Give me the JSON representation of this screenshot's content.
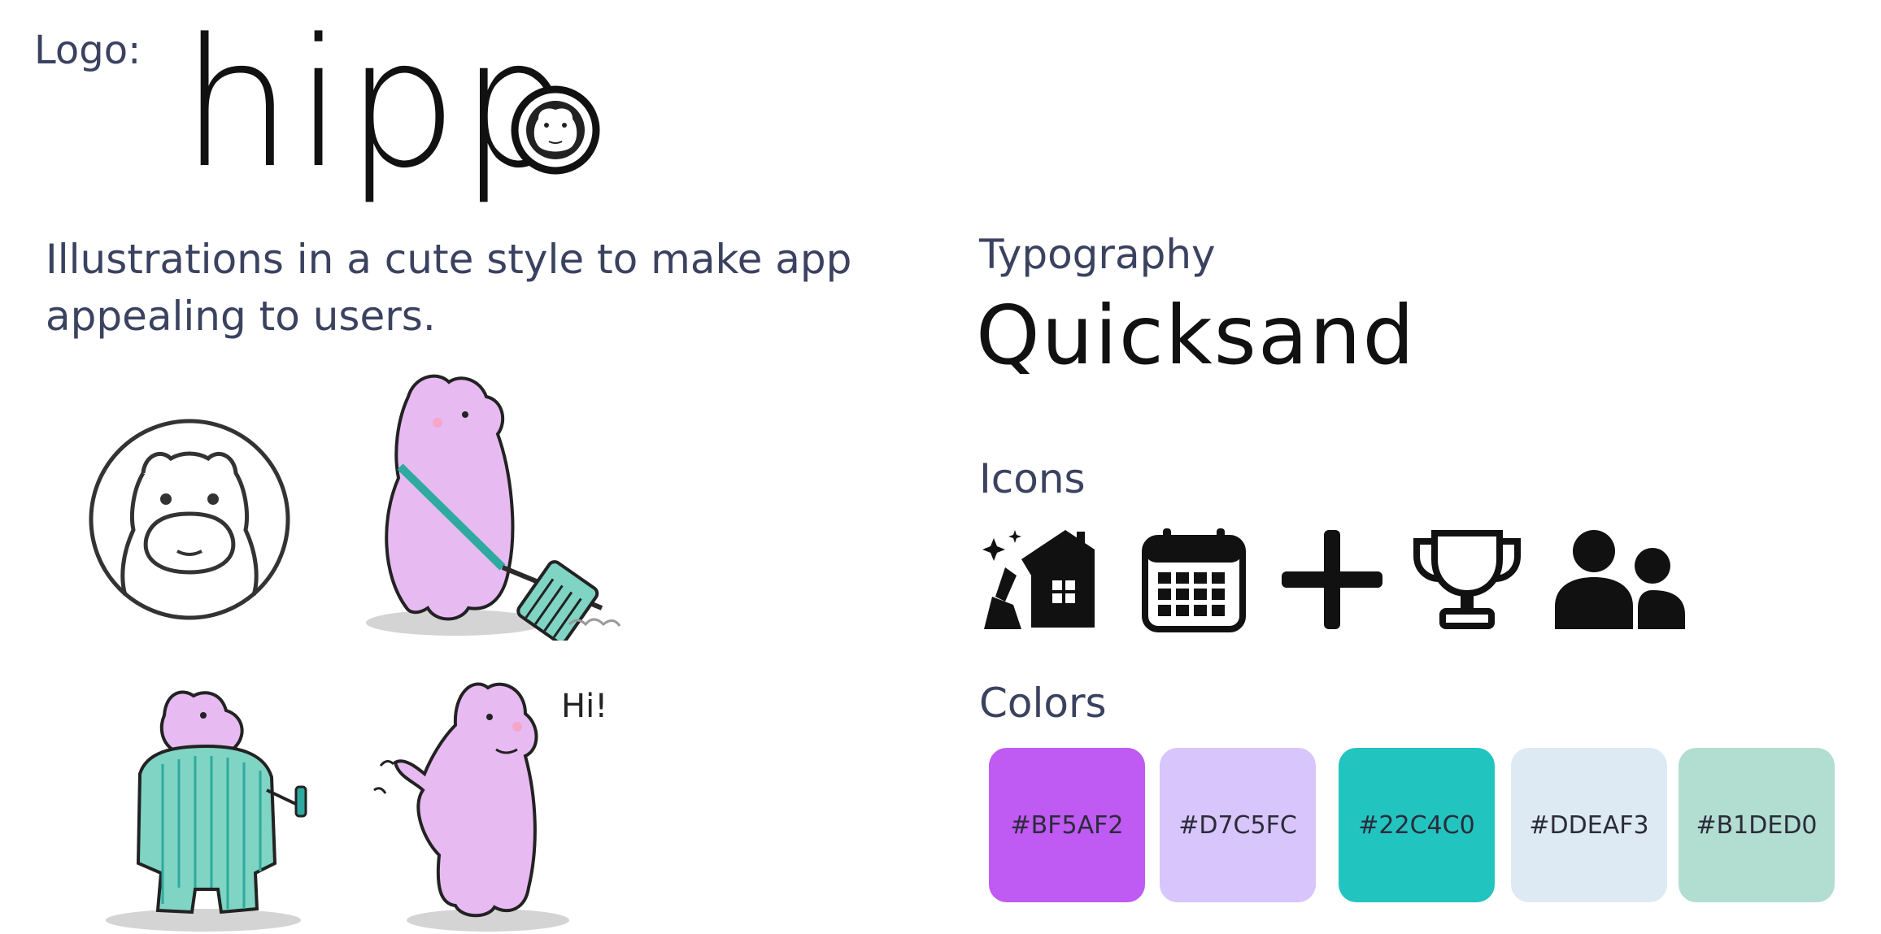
{
  "logo": {
    "label": "Logo:",
    "wordmark": "hipp"
  },
  "tagline": "Illustrations in a cute style to make app appealing to users.",
  "illustrations": {
    "hi_text": "Hi!"
  },
  "typography": {
    "label": "Typography",
    "sample": "Quicksand"
  },
  "icons": {
    "label": "Icons",
    "items": [
      "cleaning-house-icon",
      "calendar-icon",
      "plus-icon",
      "trophy-icon",
      "users-icon"
    ]
  },
  "colors": {
    "label": "Colors",
    "swatches": [
      {
        "hex": "#BF5AF2",
        "label": "#BF5AF2"
      },
      {
        "hex": "#D7C5FC",
        "label": "#D7C5FC"
      },
      {
        "hex": "#22C4C0",
        "label": "#22C4C0"
      },
      {
        "hex": "#DDEAF3",
        "label": "#DDEAF3"
      },
      {
        "hex": "#B1DED0",
        "label": "#B1DED0"
      }
    ]
  }
}
